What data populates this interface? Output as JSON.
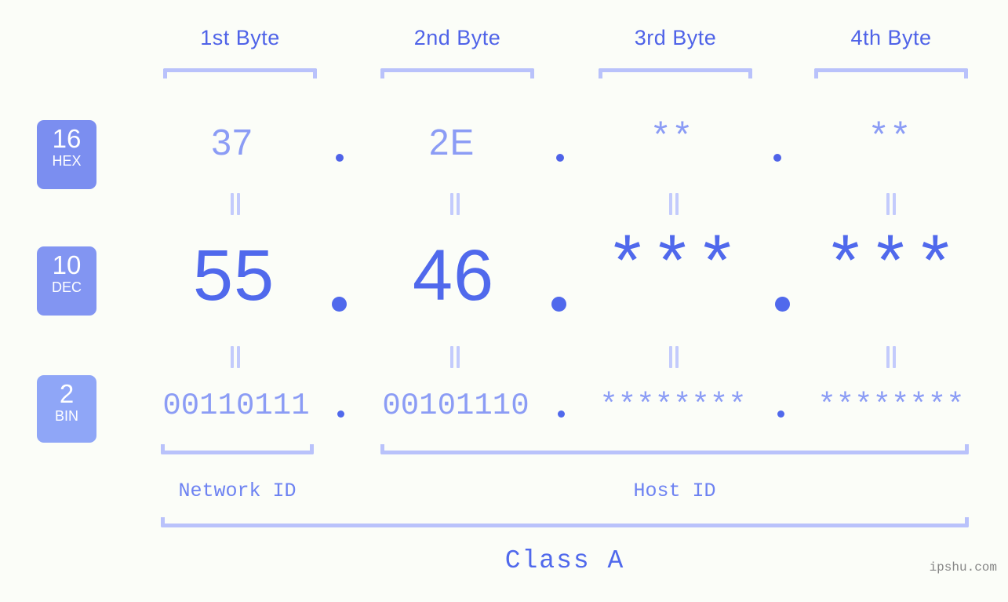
{
  "watermark": "ipshu.com",
  "byte_headers": [
    {
      "label": "1st Byte"
    },
    {
      "label": "2nd Byte"
    },
    {
      "label": "3rd Byte"
    },
    {
      "label": "4th Byte"
    }
  ],
  "bases": [
    {
      "num": "16",
      "name": "HEX",
      "color": "#7b8ef0"
    },
    {
      "num": "10",
      "name": "DEC",
      "color": "#8295f2"
    },
    {
      "num": "2",
      "name": "BIN",
      "color": "#8fa6f7"
    }
  ],
  "rows": {
    "hex": {
      "values": [
        "37",
        "2E",
        "**",
        "**"
      ],
      "separator": "."
    },
    "dec": {
      "values": [
        "55",
        "46",
        "***",
        "***"
      ],
      "separator": "."
    },
    "bin": {
      "values": [
        "00110111",
        "00101110",
        "********",
        "********"
      ],
      "separator": "."
    }
  },
  "equals_symbol": "=",
  "sections": [
    {
      "label": "Network ID"
    },
    {
      "label": "Host ID"
    }
  ],
  "class": {
    "label": "Class A"
  },
  "colors": {
    "background": "#fbfdf8",
    "heading_blue": "#4f63e8",
    "light_blue": "#8b9cf5",
    "strong_blue": "#5069ec",
    "bracket_blue": "#b9c2fb",
    "equals_blue": "#c3cbfc",
    "watermark_gray": "#868686"
  },
  "chart_data": {
    "type": "table",
    "title": "IPv4 address byte breakdown",
    "columns": [
      "1st Byte",
      "2nd Byte",
      "3rd Byte",
      "4th Byte"
    ],
    "rows": [
      {
        "base": "16",
        "base_name": "HEX",
        "cells": [
          "37",
          "2E",
          "**",
          "**"
        ]
      },
      {
        "base": "10",
        "base_name": "DEC",
        "cells": [
          "55",
          "46",
          "***",
          "***"
        ]
      },
      {
        "base": "2",
        "base_name": "BIN",
        "cells": [
          "00110111",
          "00101110",
          "********",
          "********"
        ]
      }
    ],
    "network_id_bytes": 1,
    "host_id_bytes": 3,
    "address_class": "Class A"
  }
}
